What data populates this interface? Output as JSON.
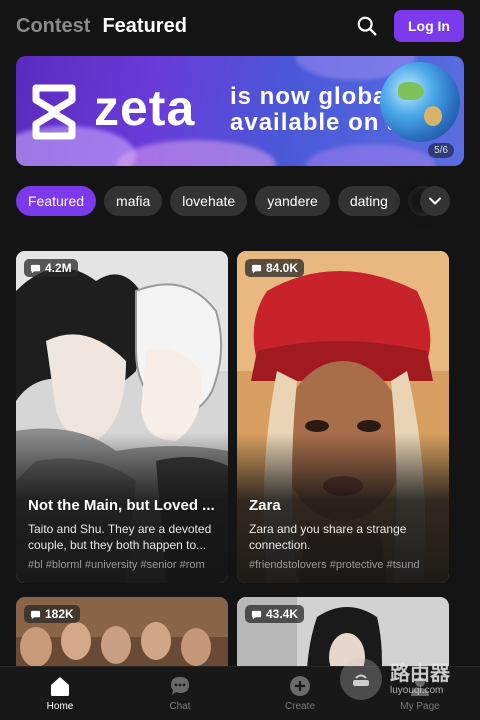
{
  "header": {
    "tab_contest": "Contest",
    "tab_featured": "Featured",
    "login_label": "Log In",
    "search_icon": "search-icon"
  },
  "banner": {
    "brand": "zeta",
    "message_line1": "is now globally",
    "message_line2": "available on app",
    "counter": "5/6"
  },
  "chips": [
    "Featured",
    "mafia",
    "lovehate",
    "yandere",
    "dating"
  ],
  "active_chip": "Featured",
  "cards": [
    {
      "count": "4.2M",
      "title": "Not the Main, but Loved ...",
      "description": "Taito and Shu. They are a devoted couple, but they both happen to...",
      "tags": "#bl #blorml #university #senior #rom"
    },
    {
      "count": "84.0K",
      "title": "Zara",
      "description": "Zara and you share a strange connection.",
      "tags": "#friendstolovers #protective #tsund"
    },
    {
      "count": "182K"
    },
    {
      "count": "43.4K"
    }
  ],
  "nav": {
    "home": "Home",
    "chat": "Chat",
    "create": "Create",
    "mypage": "My Page"
  },
  "watermark": {
    "line1": "路由器",
    "line2": "luyouqi.com"
  },
  "colors": {
    "accent": "#7c3aed",
    "background": "#141414"
  }
}
